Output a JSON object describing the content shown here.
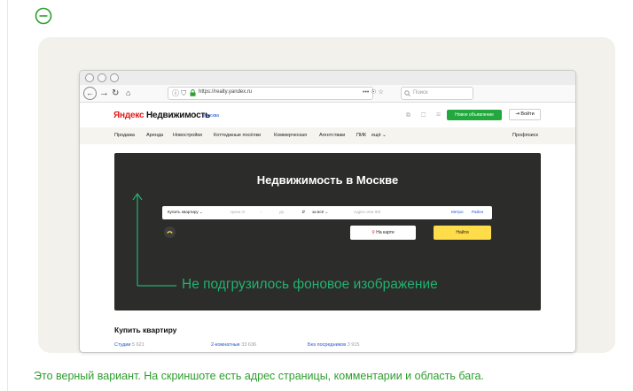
{
  "caption": "Это верный вариант. На скриншоте есть адрес страницы, комментарии и область бага.",
  "colors": {
    "accent_green": "#2e9e2e",
    "annotation_green": "#22b26e",
    "card_bg": "#f2f1ec",
    "hero_bg": "#2c2c2b",
    "post_button": "#22a83e",
    "find_button": "#ffdc4a"
  },
  "icons": {
    "collapse": "circle-minus-icon",
    "back": "back-arrow-icon",
    "forward": "forward-arrow-icon",
    "reload": "reload-icon",
    "home": "home-icon",
    "lock": "lock-icon",
    "pin": "map-pin-icon"
  },
  "browser": {
    "url": "https://realty.yandex.ru",
    "url_tools": "••• ☉ ☆",
    "search_placeholder": "Поиск"
  },
  "site": {
    "logo_first": "Яндекс",
    "logo_second": "Недвижимость",
    "city": "Москва",
    "header_icons": "⧉ ☐ ✉",
    "post_ad": "Новое объявление",
    "login": "Войти",
    "nav": [
      "Продажа",
      "Аренда",
      "Новостройки",
      "Коттеджные посёлки",
      "Коммерческая",
      "Агентствам",
      "ПИК",
      "ещё ⌄"
    ],
    "profsearch": "Профпоиск"
  },
  "hero": {
    "title": "Недвижимость в Москве",
    "deal_type": "Купить квартиру ⌄",
    "price_from": "Цена от",
    "price_to": "до",
    "currency": "₽",
    "price_for": "за всё ⌄",
    "address_placeholder": "Адрес или ЖК",
    "metro": "Метро",
    "district": "Район",
    "on_map": "На карте",
    "find": "Найти"
  },
  "annotation": "Не подгрузилось фоновое изображение",
  "buy": {
    "title": "Купить квартиру",
    "links": [
      {
        "label": "Студии",
        "count": "5 621"
      },
      {
        "label": "2-комнатные",
        "count": "33 636"
      },
      {
        "label": "Без посредников",
        "count": "3 915"
      }
    ]
  }
}
